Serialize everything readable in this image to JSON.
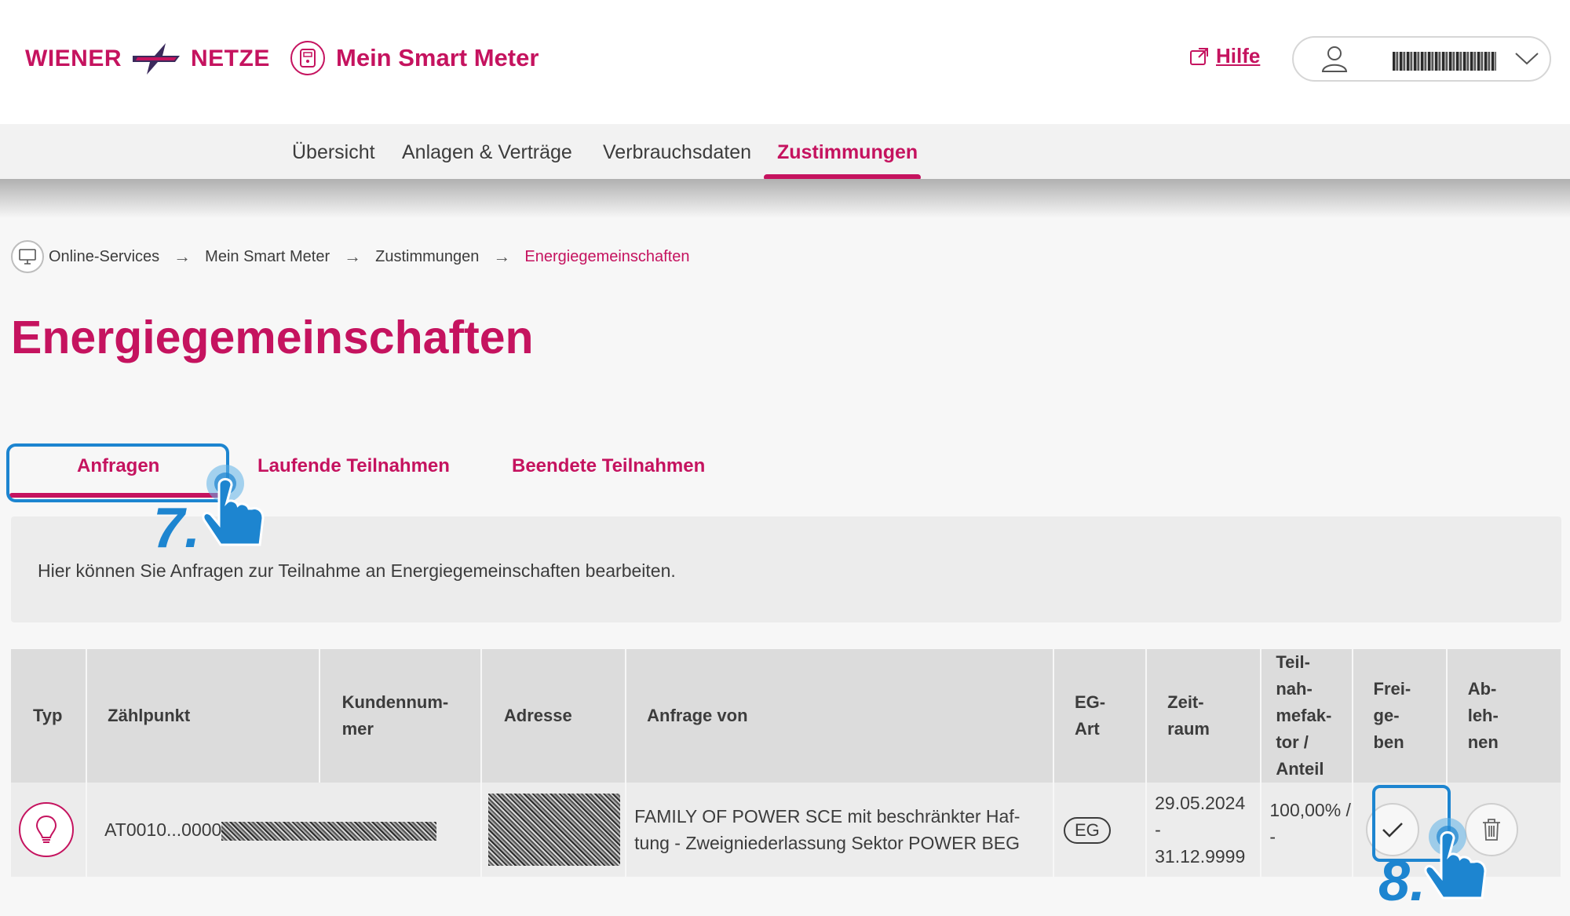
{
  "header": {
    "logo_left": "WIENER",
    "logo_right": "NETZE",
    "app_title": "Mein Smart Meter",
    "help_label": "Hilfe"
  },
  "nav": {
    "items": [
      {
        "label": "Übersicht"
      },
      {
        "label": "Anlagen & Verträge"
      },
      {
        "label": "Verbrauchsdaten"
      },
      {
        "label": "Zustimmungen"
      }
    ],
    "active_index": 3
  },
  "breadcrumb": [
    "Online-Services",
    "Mein Smart Meter",
    "Zustimmungen",
    "Energiegemeinschaften"
  ],
  "page_title": "Energiegemeinschaften",
  "tabs": [
    {
      "label": "Anfragen"
    },
    {
      "label": "Laufende Teilnahmen"
    },
    {
      "label": "Beendete Teilnahmen"
    }
  ],
  "info_text": "Hier können Sie Anfragen zur Teilnahme an Energiegemeinschaften bearbeiten.",
  "table": {
    "headers": [
      "Typ",
      "Zählpunkt",
      "Kundennum-\nmer",
      "Adresse",
      "Anfrage von",
      "EG-\nArt",
      "Zeit-\nraum",
      "Teil-\nnah-\nmefak-\ntor /\nAnteil",
      "Frei-\nge-\nben",
      "Ab-\nleh-\nnen"
    ],
    "rows": [
      {
        "zaehlpunkt": "AT0010...0000",
        "anfrage_von": "FAMILY OF POWER SCE mit beschränkter Haf- tung - Zweigniederlassung Sektor POWER BEG",
        "eg_art": "EG",
        "zeitraum_start": "29.05.2024",
        "zeitraum_sep": "-",
        "zeitraum_end": "31.12.9999",
        "anteil": "100,00% /",
        "anteil_2": "-"
      }
    ]
  },
  "annotations": {
    "step_7": "7.",
    "step_8": "8."
  },
  "colors": {
    "brand": "#c5135f",
    "annotation": "#1d85d0"
  }
}
